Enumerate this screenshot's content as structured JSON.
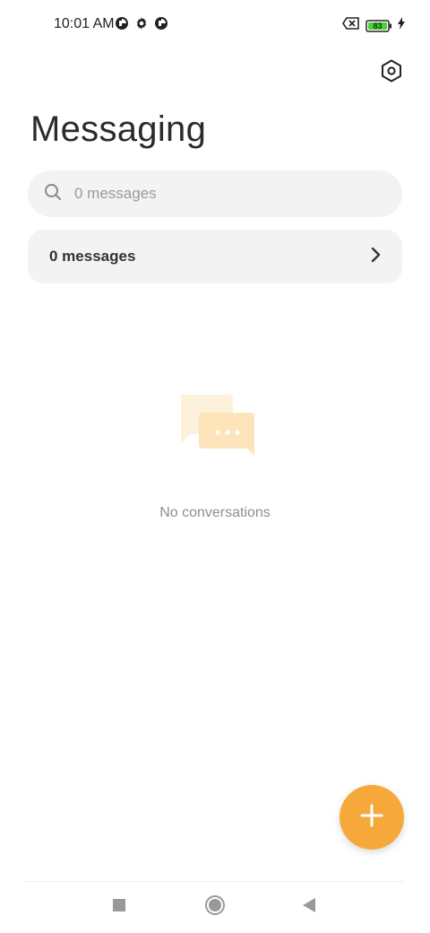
{
  "status_bar": {
    "time": "10:01 AM",
    "battery_level": "83",
    "left_icons": [
      "data-saver-icon",
      "settings-gear-icon",
      "data-saver-icon"
    ],
    "right_icons": [
      "no-sim-icon",
      "battery-icon",
      "charging-bolt-icon"
    ]
  },
  "header": {
    "title": "Messaging",
    "settings_icon": "settings-hex-icon"
  },
  "search": {
    "placeholder": "0 messages",
    "icon": "search-icon"
  },
  "messages_row": {
    "label": "0 messages",
    "icon": "chevron-right-icon"
  },
  "empty_state": {
    "text": "No conversations",
    "icon": "chat-bubbles-icon"
  },
  "fab": {
    "icon": "plus-icon",
    "color": "#f6a93a"
  },
  "nav_bar": {
    "items": [
      "recents-square-icon",
      "home-circle-icon",
      "back-triangle-icon"
    ]
  },
  "colors": {
    "accent": "#f6a93a",
    "card_background": "#f3f3f3",
    "battery_fill": "#4cd03c"
  }
}
